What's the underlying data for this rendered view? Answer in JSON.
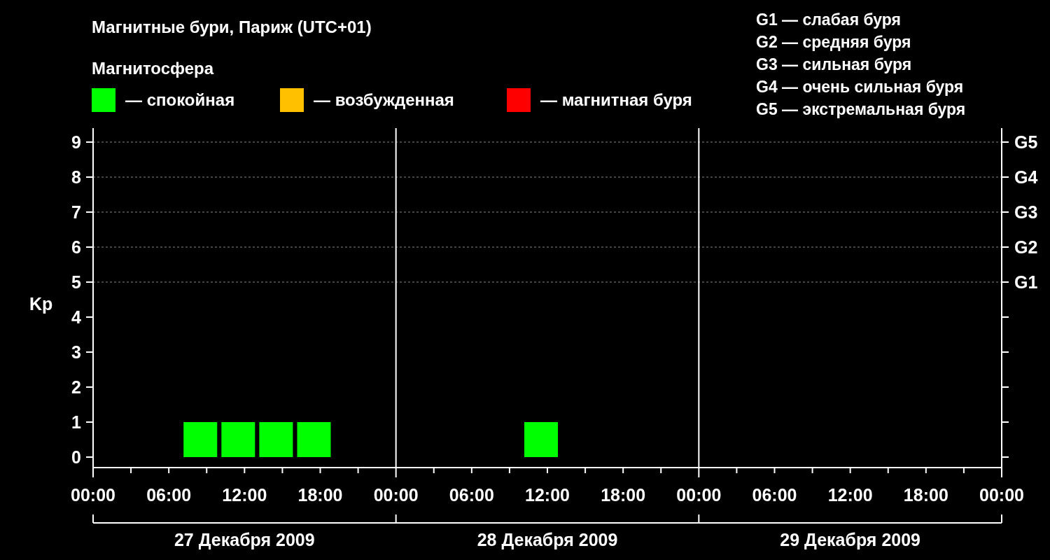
{
  "title": "Магнитные бури, Париж (UTC+01)",
  "legend": {
    "title": "Магнитосфера",
    "items": [
      {
        "label": "— спокойная",
        "color": "#00ff00"
      },
      {
        "label": "— возбужденная",
        "color": "#ffc000"
      },
      {
        "label": "— магнитная буря",
        "color": "#ff0000"
      }
    ]
  },
  "scale": [
    "G1 — слабая буря",
    "G2 — средняя буря",
    "G3 — сильная буря",
    "G4 — очень сильная буря",
    "G5 — экстремальная буря"
  ],
  "chart": {
    "chart_data": {
      "type": "bar",
      "ylabel": "Kp",
      "x": [
        "2009-12-27T08:30",
        "2009-12-27T11:30",
        "2009-12-27T14:30",
        "2009-12-27T17:30",
        "2009-12-28T11:30"
      ],
      "series": [
        {
          "color": "#00ff00",
          "values": [
            1,
            1,
            1,
            1,
            1
          ]
        }
      ],
      "grid": true,
      "xlim": [
        "2009-12-27T00:00",
        "2009-12-30T00:00"
      ],
      "ylim": [
        -0.3,
        9.4
      ],
      "xticks": [
        {
          "value": "2009-12-27T00:00",
          "label": "00:00"
        },
        {
          "value": "2009-12-27T06:00",
          "label": "06:00"
        },
        {
          "value": "2009-12-27T12:00",
          "label": "12:00"
        },
        {
          "value": "2009-12-27T18:00",
          "label": "18:00"
        },
        {
          "value": "2009-12-28T00:00",
          "label": "00:00"
        },
        {
          "value": "2009-12-28T06:00",
          "label": "06:00"
        },
        {
          "value": "2009-12-28T12:00",
          "label": "12:00"
        },
        {
          "value": "2009-12-28T18:00",
          "label": "18:00"
        },
        {
          "value": "2009-12-29T00:00",
          "label": "00:00"
        },
        {
          "value": "2009-12-29T06:00",
          "label": "06:00"
        },
        {
          "value": "2009-12-29T12:00",
          "label": "12:00"
        },
        {
          "value": "2009-12-29T18:00",
          "label": "18:00"
        },
        {
          "value": "2009-12-30T00:00",
          "label": "00:00"
        }
      ],
      "yticks": [
        0,
        1,
        2,
        3,
        4,
        5,
        6,
        7,
        8,
        9
      ]
    },
    "g_ticks": [
      "G5",
      "G4",
      "G3",
      "G2",
      "G1"
    ],
    "days": [
      "27 Декабря 2009",
      "28 Декабря 2009",
      "29 Декабря 2009"
    ]
  }
}
